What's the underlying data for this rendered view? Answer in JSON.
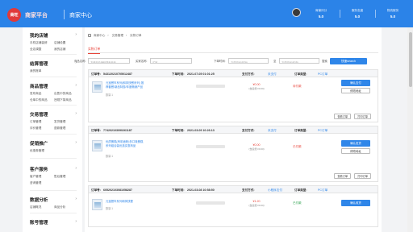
{
  "header": {
    "logo_text": "商旺",
    "brand": "商家平台",
    "title": "商家中心",
    "stats": [
      {
        "label": "商铺评分",
        "value": "5.0"
      },
      {
        "label": "服务态度",
        "value": "5.0"
      },
      {
        "label": "物流服务",
        "value": "5.0"
      }
    ]
  },
  "sidebar": {
    "groups": [
      {
        "title": "我的店铺",
        "links": [
          "手机店铺装修",
          "店铺设置",
          "全店调整",
          "我的店铺"
        ]
      },
      {
        "title": "结算管理",
        "links": [
          "我的账单"
        ]
      },
      {
        "title": "商品管理",
        "links": [
          "发布商品",
          "出售中的商品",
          "仓库中的商品",
          "违规下架商品"
        ]
      },
      {
        "title": "交易管理",
        "links": [
          "订单管理",
          "发货管理",
          "评价管理",
          "退款管理"
        ]
      },
      {
        "title": "促销推广",
        "links": [
          "优惠券管理"
        ]
      },
      {
        "title": "客户服务",
        "links": [
          "客户管理",
          "售后管理",
          "咨询管理"
        ]
      },
      {
        "title": "数据分析",
        "links": [
          "店铺概况",
          "商品分析"
        ]
      },
      {
        "title": "账号管理",
        "links": []
      }
    ]
  },
  "breadcrumb": [
    "商家中心",
    "交易管理",
    "实物订单"
  ],
  "tab": "实物订单",
  "filters": {
    "product_label": "商品名称:",
    "product_placeholder": "方便用户编码搜索商品",
    "buyer_label": "买家名称:",
    "buyer_placeholder": "买家",
    "time_label": "下单时间:",
    "time_start_placeholder": "下单时间(开始)",
    "to_label": "至",
    "time_end_placeholder": "下单时间(结束)",
    "search_label": "搜索",
    "search_button": "快速search"
  },
  "labels": {
    "order_no": "订单号:",
    "order_time": "下单时间:",
    "pay_method": "支付方式:",
    "order_type": "订单类型:",
    "qty_prefix": "数量:",
    "view_order": "查看订单",
    "print_order": "打印订单"
  },
  "orders": [
    {
      "no": "543120210705012487",
      "time": "2021-07-05 01:01:25",
      "pay_method": "未支付",
      "order_type": "PC订单",
      "product": "元宝餐车系列(和风快餐系列) 推荐套餐/新品特惠/年度畅销产品",
      "qty": "1",
      "price": "¥0.00",
      "price_note": "(含运费:¥0.00)",
      "status": "待付款",
      "btn_primary": "确认支付",
      "btn_secondary": "修改地址"
    },
    {
      "no": "774202103090261187",
      "time": "2021-03-09 10:26:13",
      "pay_method": "未支付",
      "order_type": "PC订单",
      "product": "优质蛋糕(有机面粉)多口味蛋糕系列组合装优选实惠商品",
      "qty": "1",
      "price": "¥0.00",
      "price_note": "(含运费:¥0.00)",
      "status": "已付款",
      "btn_primary": "确认发货",
      "btn_secondary": "修改地址"
    },
    {
      "no": "605202103081058287",
      "time": "2021-03-08 10:58:50",
      "pay_method": "小程序支付",
      "order_type": "PC订单",
      "product": "元宝餐车系列和风快餐",
      "qty": "1",
      "price": "¥1.20",
      "price_note": "(含运费:¥0.00)",
      "status": "已付款",
      "btn_primary": "确认收货",
      "btn_secondary": ""
    }
  ]
}
